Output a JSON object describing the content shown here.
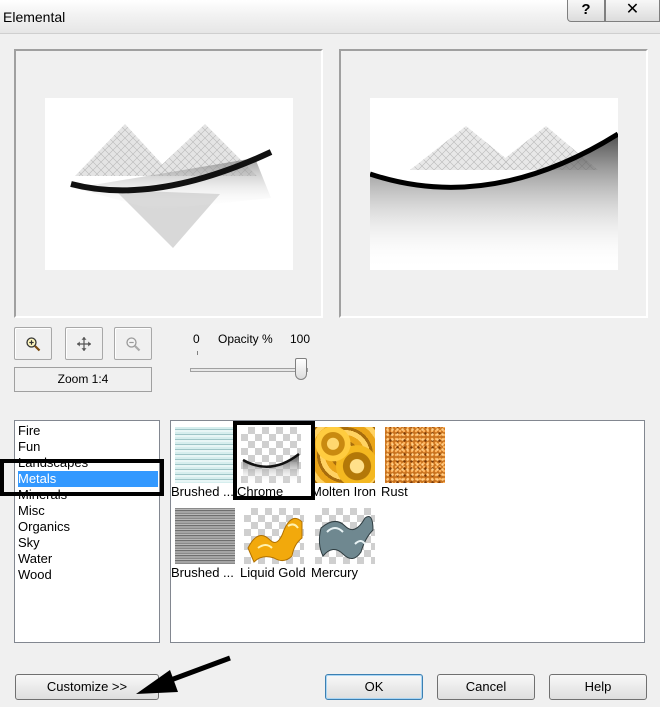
{
  "window": {
    "title": "Elemental",
    "help_label": "?",
    "close_label": "✕"
  },
  "zoom": {
    "label": "Zoom 1:4"
  },
  "opacity": {
    "label": "Opacity %",
    "min_label": "0",
    "max_label": "100",
    "value": 100
  },
  "categories": {
    "items": [
      "Fire",
      "Fun",
      "Landscapes",
      "Metals",
      "Minerals",
      "Misc",
      "Organics",
      "Sky",
      "Water",
      "Wood"
    ],
    "selected": "Metals"
  },
  "presets": [
    {
      "label": "Brushed ...",
      "icon": "brushed-horizontal-thumbnail"
    },
    {
      "label": "Chrome",
      "icon": "chrome-thumbnail"
    },
    {
      "label": "Molten Iron",
      "icon": "molten-iron-thumbnail"
    },
    {
      "label": "Rust",
      "icon": "rust-thumbnail"
    },
    {
      "label": "Brushed ...",
      "icon": "brushed-gray-thumbnail"
    },
    {
      "label": "Liquid Gold",
      "icon": "liquid-gold-thumbnail"
    },
    {
      "label": "Mercury",
      "icon": "mercury-thumbnail"
    }
  ],
  "buttons": {
    "customize": "Customize      >>",
    "ok": "OK",
    "cancel": "Cancel",
    "help": "Help"
  },
  "colors": {
    "selection": "#3399ff",
    "annotation": "#000000"
  }
}
